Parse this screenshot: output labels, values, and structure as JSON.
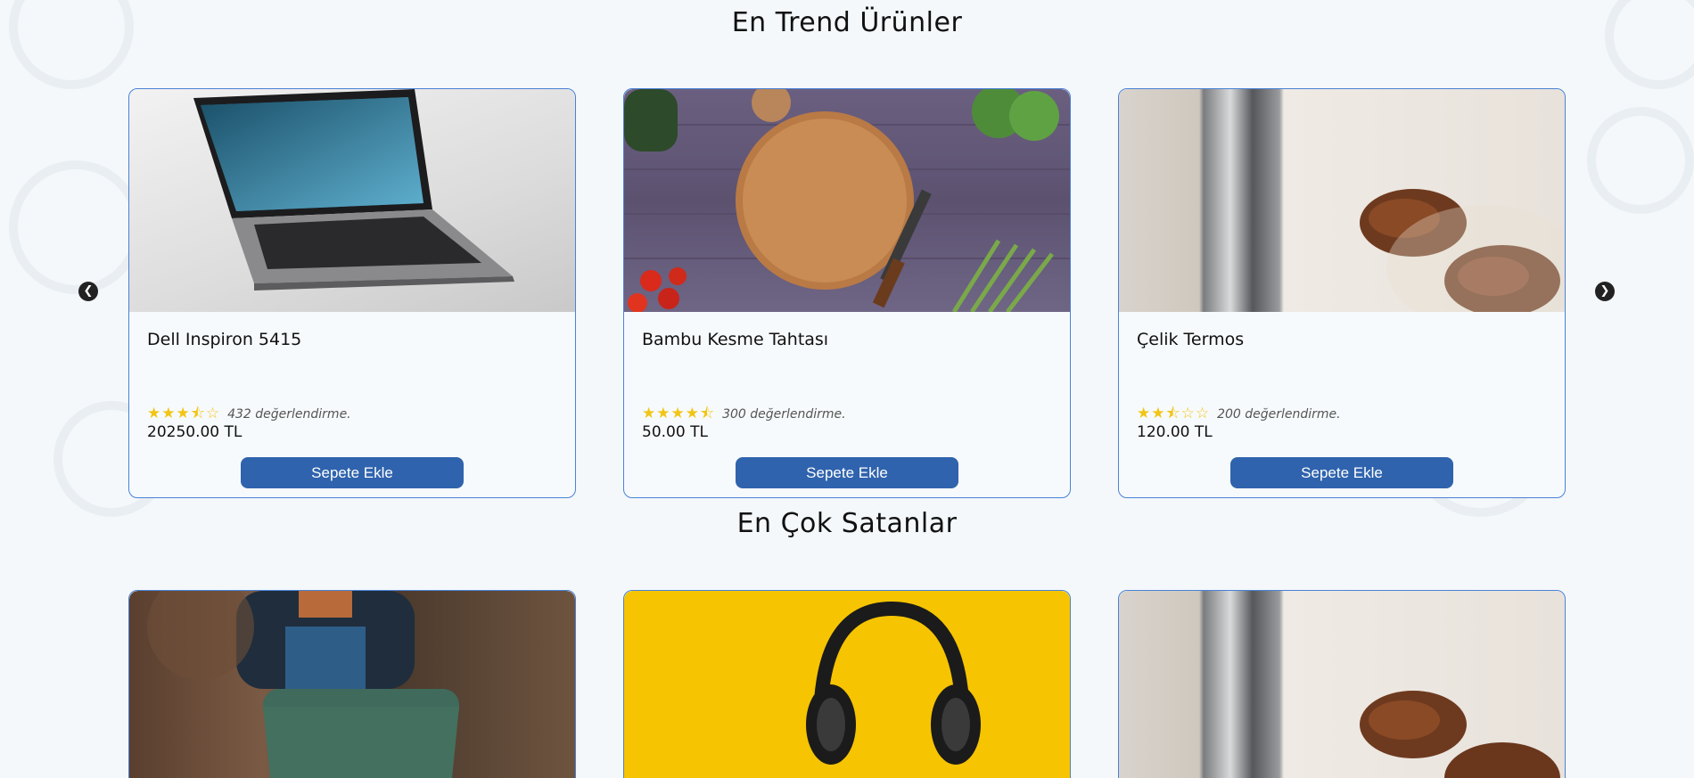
{
  "sections": {
    "trend_title": "En Trend Ürünler",
    "best_title": "En Çok Satanlar"
  },
  "trend_products": [
    {
      "name": "Dell Inspiron 5415",
      "rating": 3.5,
      "reviews": "432 değerlendirme.",
      "price": "20250.00 TL",
      "button": "Sepete Ekle"
    },
    {
      "name": "Bambu Kesme Tahtası",
      "rating": 4.5,
      "reviews": "300 değerlendirme.",
      "price": "50.00 TL",
      "button": "Sepete Ekle"
    },
    {
      "name": "Çelik Termos",
      "rating": 2.5,
      "reviews": "200 değerlendirme.",
      "price": "120.00 TL",
      "button": "Sepete Ekle"
    }
  ],
  "icons": {
    "prev": "chevron-left-icon",
    "next": "chevron-right-icon",
    "star": "star-icon"
  },
  "colors": {
    "accent": "#2f63ad",
    "card_border": "#4a82d6",
    "star": "#f2c515"
  }
}
